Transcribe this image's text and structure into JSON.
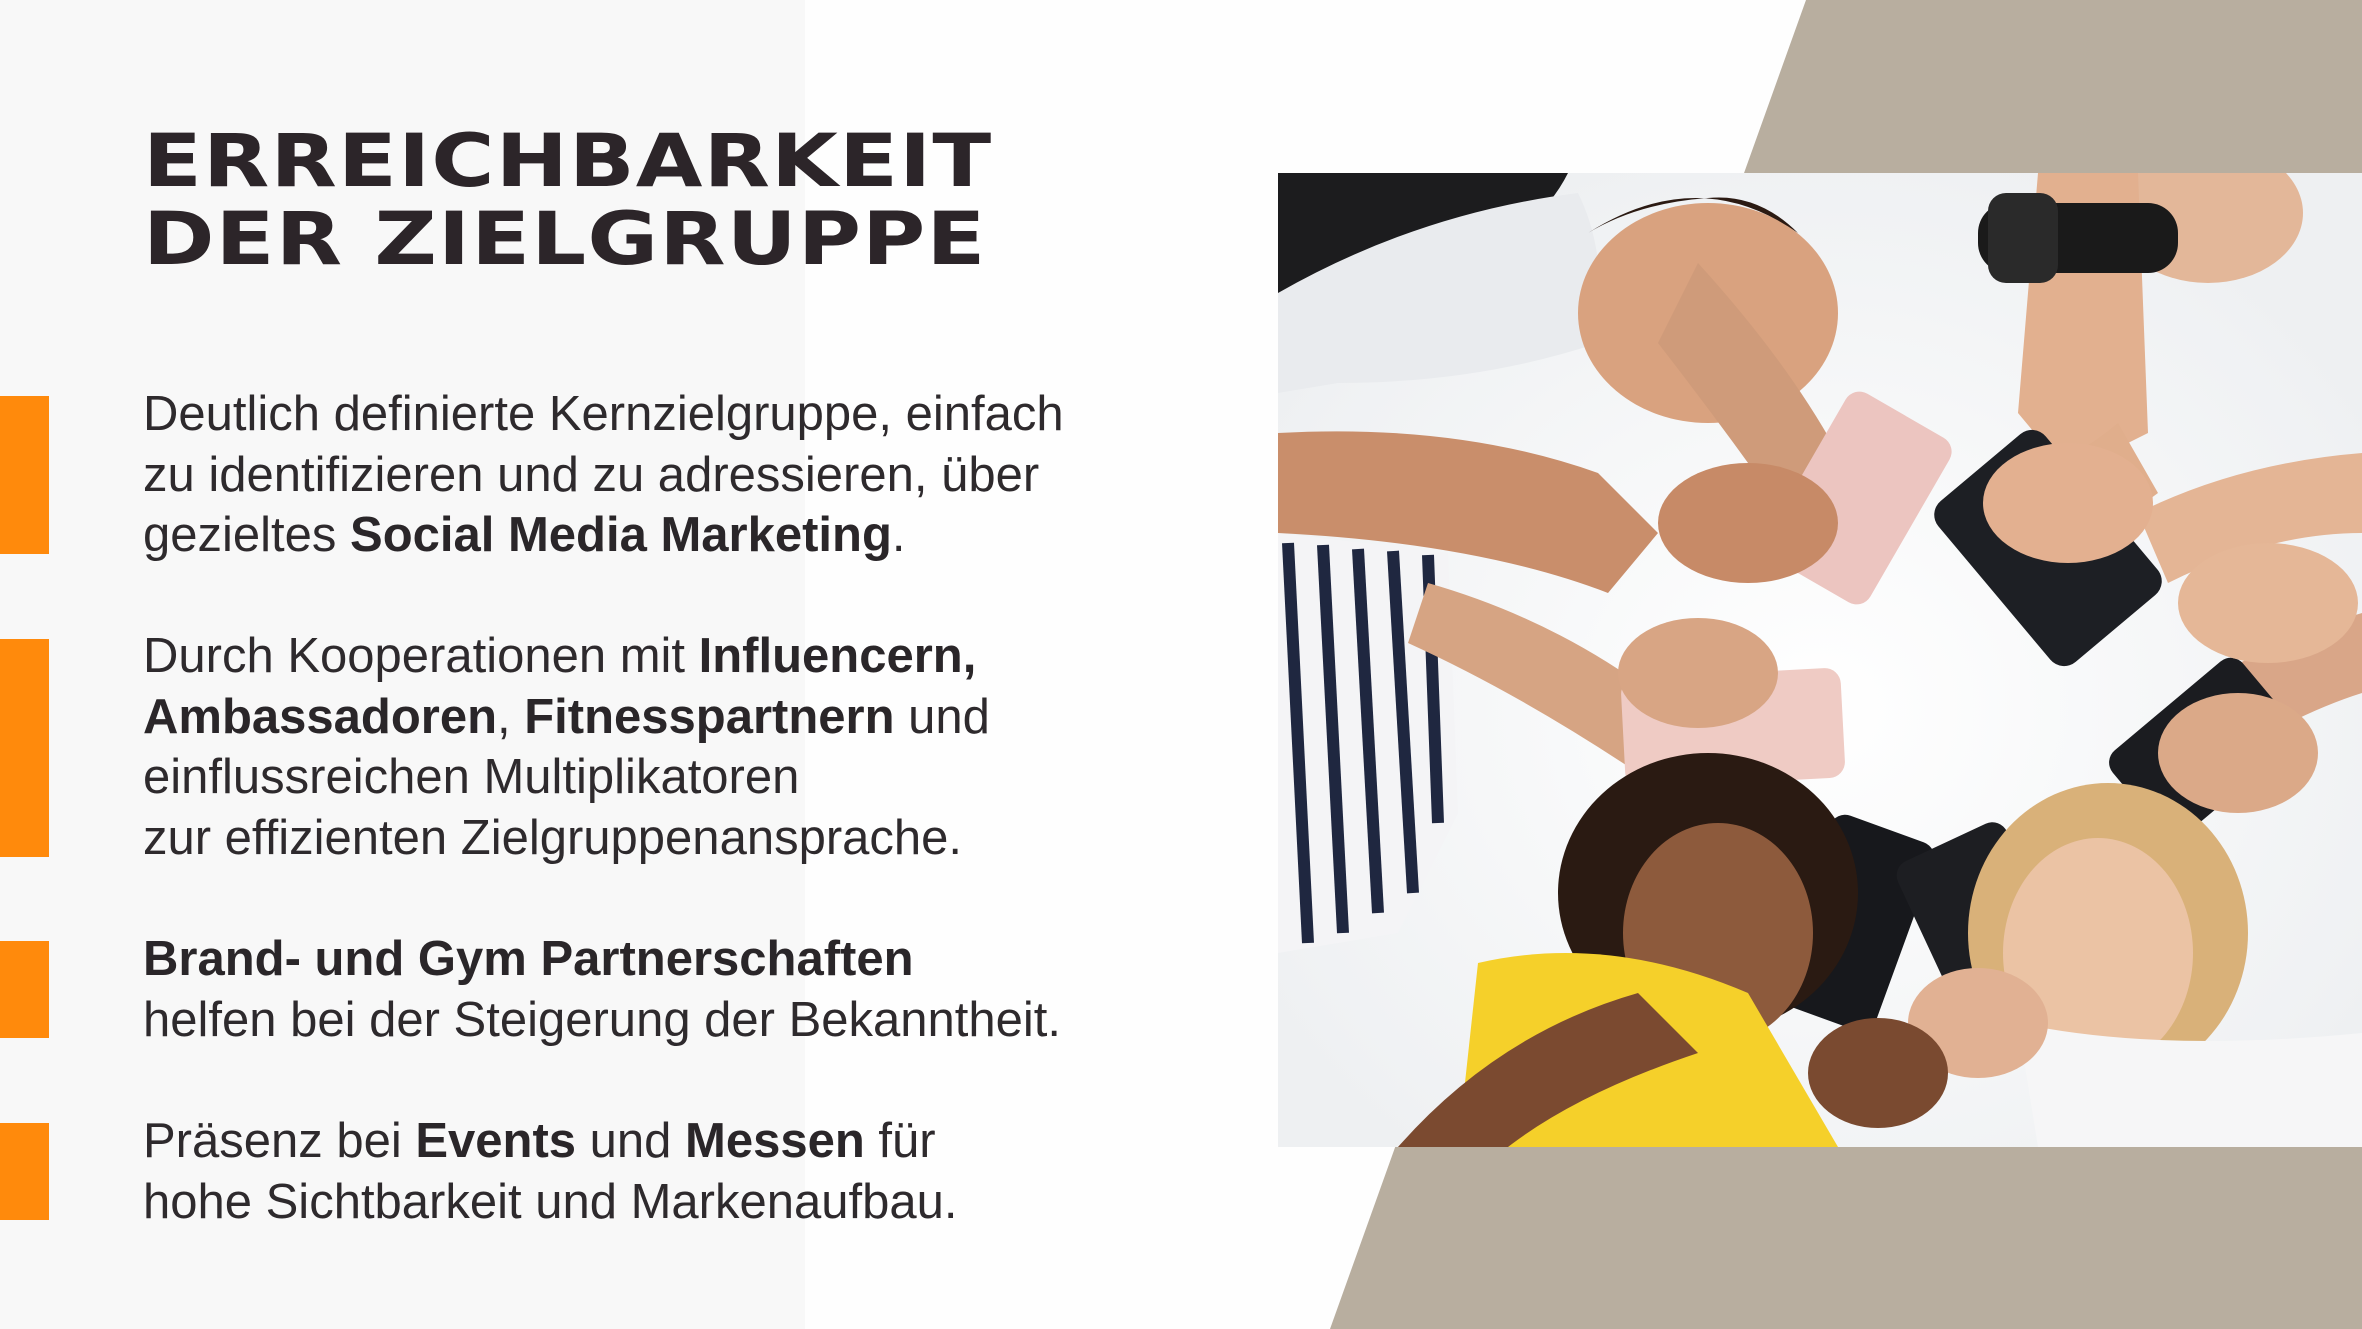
{
  "slide": {
    "title_line1": "ERREICHBARKEIT",
    "title_line2": "DER ZIELGRUPPE",
    "accent_color": "#ff8a0c",
    "beige_color": "#b8ae9f",
    "text_color": "#2e2a2d"
  },
  "points": [
    {
      "t1": "Deutlich definierte Kernzielgruppe, einfach",
      "t2": "zu identifizieren und zu adressieren, über",
      "t3": "gezieltes ",
      "b1": "Social Media Marketing",
      "t4": "."
    },
    {
      "t1": "Durch Kooperationen mit ",
      "b1": "Influencern,",
      "b2": "Ambassadoren",
      "t2": ", ",
      "b3": "Fitnesspartnern",
      "t3": " und",
      "t4": "einflussreichen Multiplikatoren",
      "t5": "zur effizienten Zielgruppenansprache."
    },
    {
      "b1": "Brand- und Gym Partnerschaften",
      "t1": "helfen bei der Steigerung der Bekanntheit."
    },
    {
      "t1": "Präsenz bei ",
      "b1": "Events",
      "t2": " und ",
      "b2": "Messen",
      "t3": " für",
      "t4": "hohe Sichtbarkeit und Markenaufbau."
    }
  ],
  "photo": {
    "icon": "group-looking-at-smartphones-photo"
  }
}
